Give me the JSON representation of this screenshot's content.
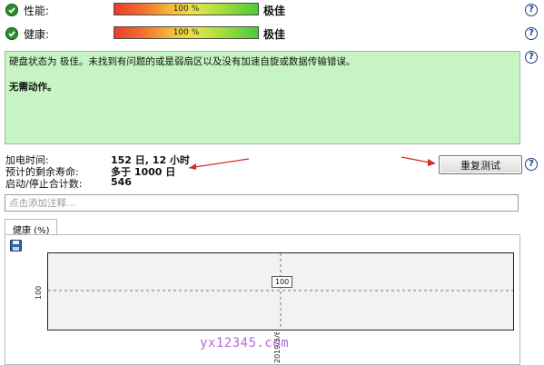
{
  "rows": [
    {
      "label": "性能:",
      "meter_value": "100 %",
      "meter_fraction": 1.0,
      "status": "极佳"
    },
    {
      "label": "健康:",
      "meter_value": "100 %",
      "meter_fraction": 1.0,
      "status": "极佳"
    }
  ],
  "help_glyph": "?",
  "status_box": {
    "line1": "硬盘状态为 极佳。未找到有问题的或是弱扇区以及没有加速自旋或数据传输错误。",
    "line2": "无需动作。"
  },
  "info": {
    "power_on_label": "加电时间:",
    "power_on_value": "152 日, 12 小时",
    "life_label": "预计的剩余寿命:",
    "life_value": "多于 1000 日",
    "start_stop_label": "启动/停止合计数:",
    "start_stop_value": "546"
  },
  "retest_button": "重复测试",
  "comment": {
    "value": "",
    "placeholder": "点击添加注释..."
  },
  "chart_tab": "健康 (%)",
  "chart_data": {
    "type": "line",
    "title": "健康 (%)",
    "x": [
      "2019/5/6"
    ],
    "values": [
      100
    ],
    "point_labels": [
      "100"
    ],
    "xlabel": "",
    "ylabel": "",
    "y_tick_labels": [
      "100"
    ],
    "x_tick_labels": [
      "2019/5/6"
    ],
    "grid": true
  },
  "watermark": "yx12345.com",
  "colors": {
    "status_bg": "#c6f5c3",
    "check_green": "#2c8d2f",
    "help_blue": "#1d3f88",
    "arrow_red": "#d62b2b",
    "watermark": "#b56ad8"
  }
}
